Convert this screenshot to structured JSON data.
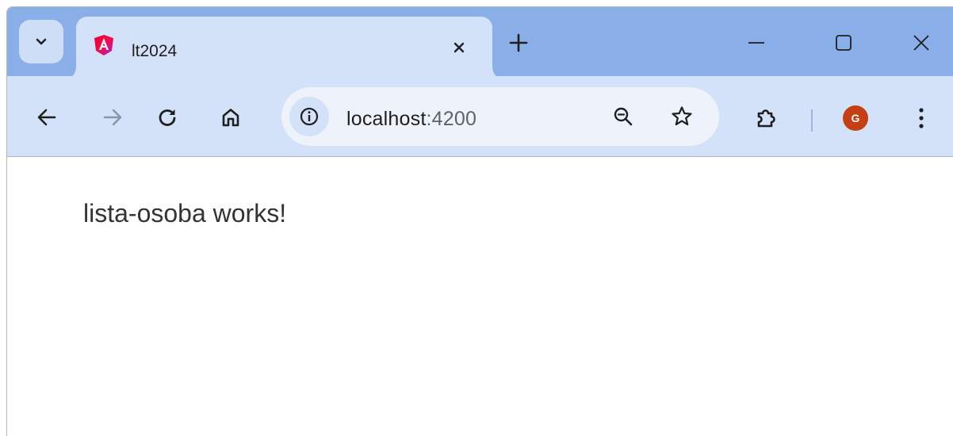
{
  "tab": {
    "title": "lt2024"
  },
  "address_bar": {
    "host": "localhost",
    "port": ":4200"
  },
  "profile": {
    "initial": "G",
    "color": "#c53f12"
  },
  "page": {
    "text": "lista-osoba works!"
  },
  "icons": {
    "tab_search": "chevron-down-icon",
    "favicon": "angular-logo-icon",
    "tab_close": "close-icon",
    "new_tab": "plus-icon",
    "minimize": "minimize-icon",
    "maximize": "maximize-icon",
    "window_close": "close-icon",
    "back": "arrow-left-icon",
    "forward": "arrow-right-icon",
    "reload": "reload-icon",
    "home": "home-icon",
    "site_info": "info-icon",
    "zoom": "zoom-out-icon",
    "bookmark": "star-icon",
    "extensions": "puzzle-icon",
    "menu": "kebab-menu-icon"
  }
}
